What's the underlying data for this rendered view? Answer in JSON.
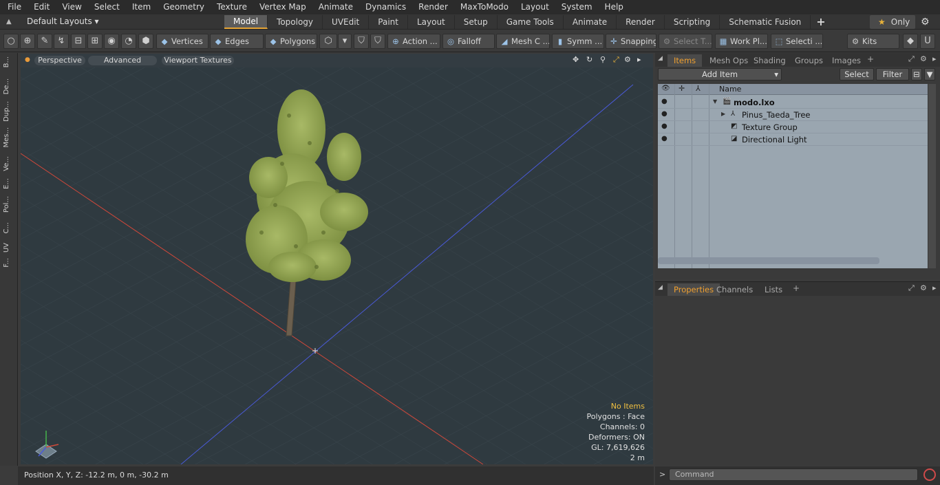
{
  "menu": [
    "File",
    "Edit",
    "View",
    "Select",
    "Item",
    "Geometry",
    "Texture",
    "Vertex Map",
    "Animate",
    "Dynamics",
    "Render",
    "MaxToModo",
    "Layout",
    "System",
    "Help"
  ],
  "layouts_label": "Default Layouts",
  "tabs": [
    "Model",
    "Topology",
    "UVEdit",
    "Paint",
    "Layout",
    "Setup",
    "Game Tools",
    "Animate",
    "Render",
    "Scripting",
    "Schematic Fusion"
  ],
  "active_tab": "Model",
  "only_label": "Only",
  "toolbar": {
    "vertices": "Vertices",
    "edges": "Edges",
    "polygons": "Polygons",
    "action": "Action ...",
    "falloff": "Falloff",
    "mesh_c": "Mesh C ...",
    "symm": "Symm ...",
    "snapping": "Snapping",
    "select_t": "Select T...",
    "work_pl": "Work Pl...",
    "selecti": "Selecti ...",
    "kits": "Kits"
  },
  "left_tabs": [
    "B...",
    "De...",
    "Dup...",
    "Mes...",
    "Ve...",
    "E...",
    "Pol...",
    "C...",
    "UV",
    "F..."
  ],
  "viewport": {
    "perspective": "Perspective",
    "advanced": "Advanced",
    "textures": "Viewport Textures",
    "info": {
      "no_items": "No Items",
      "polygons": "Polygons : Face",
      "channels": "Channels: 0",
      "deformers": "Deformers: ON",
      "gl": "GL: 7,619,626",
      "scale": "2 m"
    }
  },
  "status": {
    "position": "Position X, Y, Z:   -12.2 m, 0 m, -30.2 m"
  },
  "items_panel": {
    "tabs": [
      "Items",
      "Mesh Ops",
      "Shading",
      "Groups",
      "Images"
    ],
    "active_tab": "Items",
    "add_item": "Add Item",
    "select": "Select",
    "filter": "Filter",
    "col_name": "Name",
    "rows": [
      {
        "label": "modo.lxo",
        "depth": 0,
        "expand": "▼"
      },
      {
        "label": "Pinus_Taeda_Tree",
        "depth": 1,
        "expand": "▶"
      },
      {
        "label": "Texture Group",
        "depth": 1,
        "expand": ""
      },
      {
        "label": "Directional Light",
        "depth": 1,
        "expand": ""
      }
    ]
  },
  "props_panel": {
    "tabs": [
      "Properties",
      "Channels",
      "Lists"
    ],
    "active_tab": "Properties"
  },
  "command": {
    "placeholder": "Command",
    "prompt": ">"
  },
  "colors": {
    "accent": "#e8a534",
    "x_axis": "#d0483a",
    "z_axis": "#4a5ad8",
    "foliage": "#9aab5a"
  }
}
